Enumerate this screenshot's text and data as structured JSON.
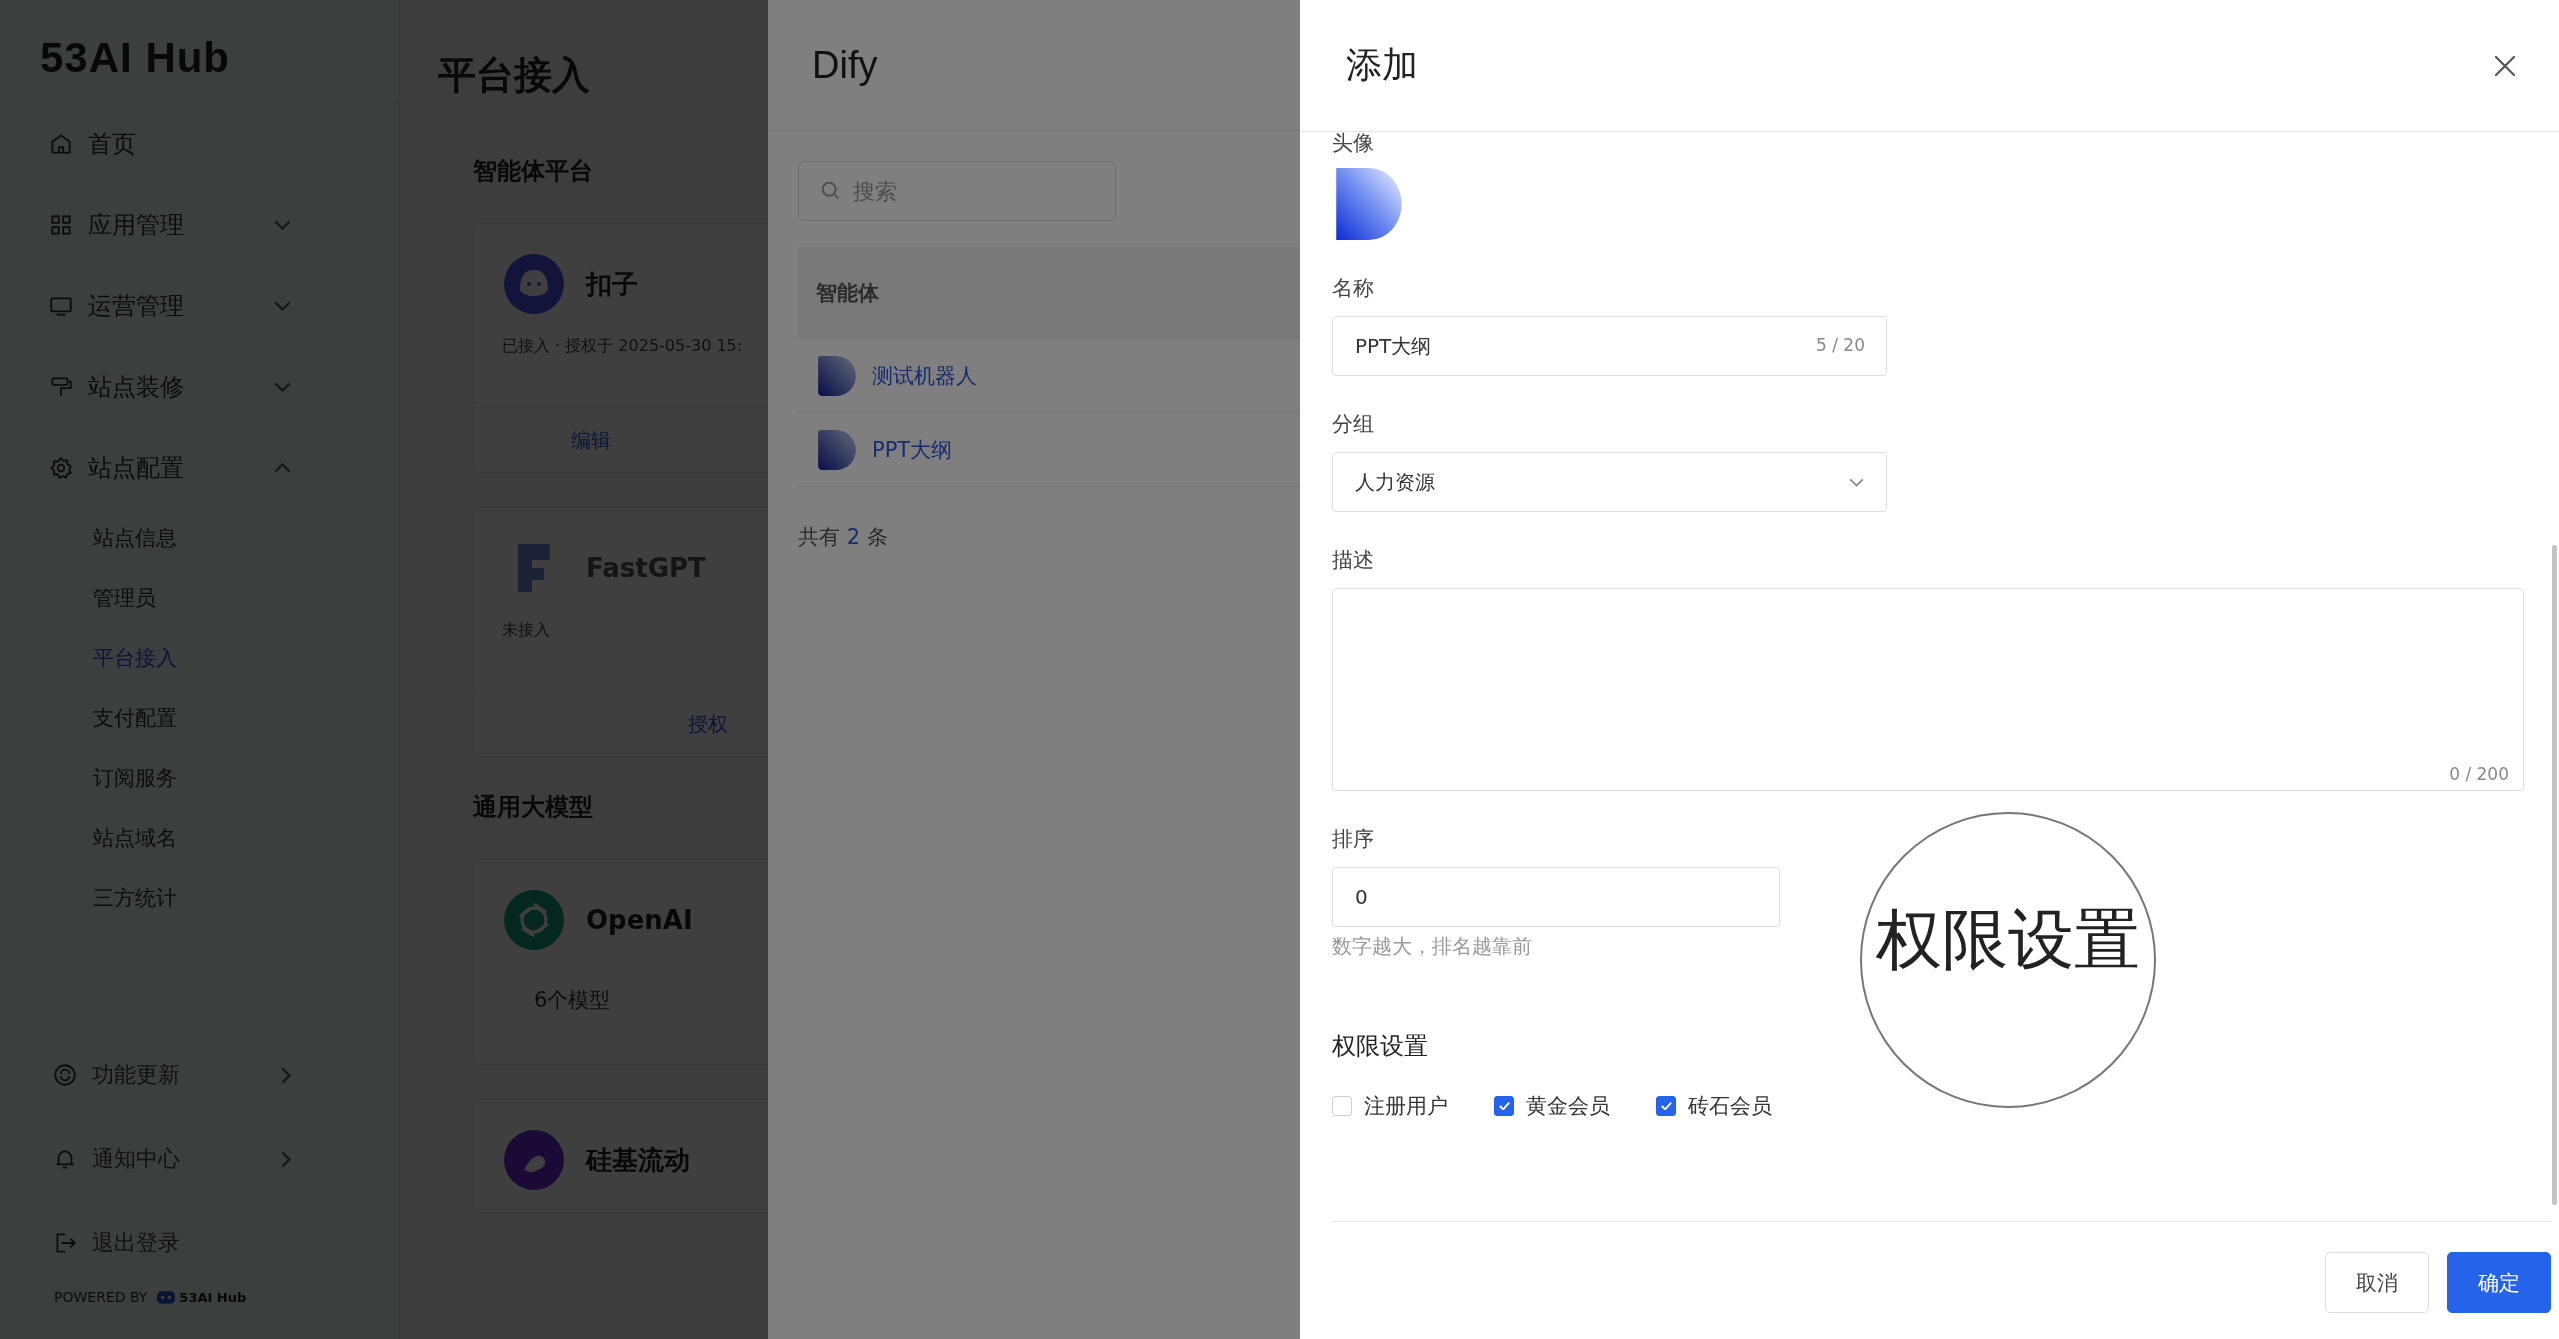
{
  "sidebar": {
    "logo": "53AI Hub",
    "items": [
      {
        "label": "首页",
        "kind": "link"
      },
      {
        "label": "应用管理",
        "kind": "group",
        "expanded": false
      },
      {
        "label": "运营管理",
        "kind": "group",
        "expanded": false
      },
      {
        "label": "站点装修",
        "kind": "group",
        "expanded": false
      },
      {
        "label": "站点配置",
        "kind": "group",
        "expanded": true,
        "children": [
          {
            "label": "站点信息",
            "selected": false
          },
          {
            "label": "管理员",
            "selected": false
          },
          {
            "label": "平台接入",
            "selected": true
          },
          {
            "label": "支付配置",
            "selected": false
          },
          {
            "label": "订阅服务",
            "selected": false
          },
          {
            "label": "站点域名",
            "selected": false
          },
          {
            "label": "三方统计",
            "selected": false
          }
        ]
      }
    ],
    "footer_items": [
      {
        "label": "功能更新",
        "has_arrow": true
      },
      {
        "label": "通知中心",
        "has_arrow": true
      },
      {
        "label": "退出登录",
        "has_arrow": false
      }
    ],
    "powered_by": {
      "label": "POWERED BY",
      "brand": "53AI Hub"
    }
  },
  "main": {
    "title": "平台接入",
    "sections": [
      {
        "title": "智能体平台",
        "cards": [
          {
            "name": "扣子",
            "status": "已接入 · 授权于 2025-05-30 15:",
            "actions": [
              "编辑"
            ]
          },
          {
            "name": "FastGPT",
            "status": "未接入",
            "actions": [
              "授权"
            ]
          }
        ]
      },
      {
        "title": "通用大模型",
        "cards": [
          {
            "name": "OpenAI",
            "detail": "6个模型"
          },
          {
            "name": "硅基流动"
          }
        ]
      }
    ]
  },
  "dify_drawer": {
    "title": "Dify",
    "search": {
      "placeholder": "搜索"
    },
    "table": {
      "columns": [
        "智能体"
      ],
      "rows": [
        {
          "name": "测试机器人"
        },
        {
          "name": "PPT大纲"
        }
      ]
    },
    "total": {
      "prefix": "共有",
      "count": "2",
      "suffix": "条"
    }
  },
  "add_drawer": {
    "title": "添加",
    "avatar": {
      "label": "头像"
    },
    "name": {
      "label": "名称",
      "value": "PPT大纲",
      "counter": "5 / 20"
    },
    "group": {
      "label": "分组",
      "value": "人力资源"
    },
    "description": {
      "label": "描述",
      "counter": "0 / 200"
    },
    "sort": {
      "label": "排序",
      "value": "0",
      "hint": "数字越大，排名越靠前"
    },
    "permissions": {
      "title": "权限设置",
      "options": [
        {
          "label": "注册用户",
          "checked": false
        },
        {
          "label": "黄金会员",
          "checked": true
        },
        {
          "label": "砖石会员",
          "checked": true
        }
      ]
    },
    "buttons": [
      {
        "label": "取消",
        "kind": "secondary"
      },
      {
        "label": "确定",
        "kind": "primary"
      }
    ],
    "magnifier": {
      "text": "权限设置"
    }
  }
}
